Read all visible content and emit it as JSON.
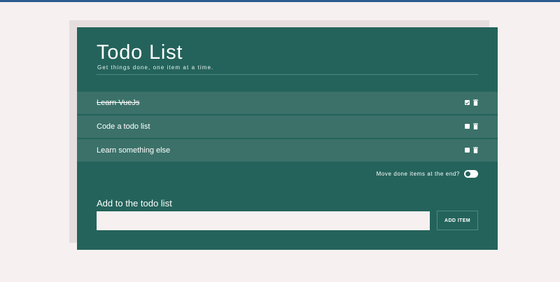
{
  "header": {
    "title": "Todo List",
    "subtitle": "Get things done, one item at a time."
  },
  "todos": [
    {
      "label": "Learn VueJs",
      "done": true
    },
    {
      "label": "Code a todo list",
      "done": false
    },
    {
      "label": "Learn something else",
      "done": false
    }
  ],
  "settings": {
    "move_done_label": "Move done items at the end?",
    "move_done_enabled": false
  },
  "add_form": {
    "label": "Add to the todo list",
    "input_value": "",
    "input_placeholder": "",
    "button_label": "ADD ITEM"
  },
  "colors": {
    "background": "#f6f0f0",
    "card": "#24635b",
    "item_row": "#3b7169",
    "top_bar": "#2c5c8f"
  }
}
